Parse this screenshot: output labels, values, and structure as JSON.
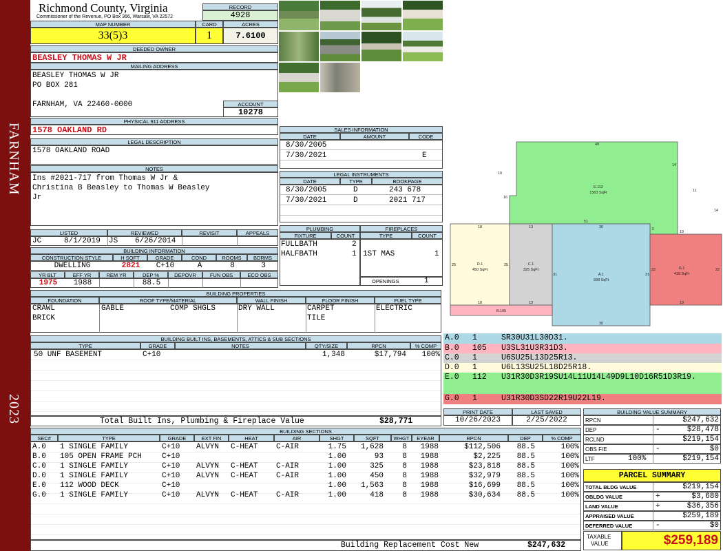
{
  "sidebar": {
    "city": "FARNHAM",
    "year": "2023"
  },
  "header": {
    "county": "Richmond County, Virginia",
    "office": "Commissioner of the Revenue, PO Box 366, Warsaw, VA 22572",
    "record_label": "RECORD",
    "record": "4928",
    "map_label": "MAP NUMBER",
    "map": "33(5)3",
    "card_label": "CARD",
    "card": "1",
    "acres_label": "ACRES",
    "acres": "7.6100"
  },
  "owner": {
    "deeded_label": "DEEDED OWNER",
    "deeded": "BEASLEY THOMAS W JR",
    "mailing_label": "MAILING ADDRESS",
    "mailing": [
      "BEASLEY THOMAS W JR",
      "PO BOX 281",
      "",
      "FARNHAM, VA 22460-0000"
    ],
    "account_label": "ACCOUNT",
    "account": "10278",
    "address_label": "PHYSICAL 911 ADDRESS",
    "address": "1578 OAKLAND RD",
    "legal_label": "LEGAL DESCRIPTION",
    "legal": "1578 OAKLAND ROAD",
    "notes_label": "NOTES",
    "notes": [
      "Ins #2021-717 from Thomas W Jr &",
      "Christina B Beasley to Thomas W Beasley",
      "Jr"
    ]
  },
  "listing": {
    "headers": [
      "LISTED",
      "REVIEWED",
      "REVISIT",
      "APPEALS"
    ],
    "listed_by": "JC",
    "listed": "8/1/2019",
    "reviewed_by": "JS",
    "reviewed": "6/26/2014"
  },
  "building_info": {
    "title": "BUILDING INFORMATION",
    "headers": [
      "CONSTRUCTION STYLE",
      "H SQFT",
      "GRADE",
      "COND",
      "ROOMS",
      "BDRMS"
    ],
    "values": [
      "DWELLING",
      "2821",
      "C+10",
      "A",
      "8",
      "3"
    ],
    "headers2": [
      "YR BLT",
      "EFF YR",
      "REM YR",
      "DEP %",
      "DEPOVR",
      "FUN OBS",
      "ECO OBS"
    ],
    "values2": [
      "1975",
      "1988",
      "",
      "88.5",
      "",
      "",
      ""
    ]
  },
  "properties": {
    "title": "BUILDING PROPERTIES",
    "headers": [
      "FOUNDATION",
      "ROOF TYPE/MATERIAL",
      "WALL FINISH",
      "FLOOR FINISH",
      "FUEL TYPE"
    ],
    "foundation": [
      "CRAWL",
      "BRICK"
    ],
    "roof_type": "GABLE",
    "roof_material": "COMP SHGLS",
    "wall": "DRY WALL",
    "floor": [
      "CARPET",
      "TILE"
    ],
    "fuel": "ELECTRIC"
  },
  "builtins": {
    "title": "BUILDING BUILT INS, BASEMENTS, ATTICS & SUB SECTIONS",
    "headers": [
      "TYPE",
      "GRADE",
      "NOTES",
      "QTY/SIZE",
      "RPCN",
      "% COMP"
    ],
    "rows": [
      {
        "type": "50 UNF BASEMENT",
        "grade": "C+10",
        "notes": "",
        "qty": "1,348",
        "rpcn": "$17,794",
        "comp": "100%"
      }
    ],
    "total_label": "Total Built Ins, Plumbing & Fireplace Value",
    "total": "$28,771"
  },
  "sales": {
    "title": "SALES INFORMATION",
    "headers": [
      "DATE",
      "AMOUNT",
      "CODE"
    ],
    "rows": [
      {
        "date": "8/30/2005",
        "amount": "",
        "code": ""
      },
      {
        "date": "7/30/2021",
        "amount": "",
        "code": "E"
      }
    ]
  },
  "legal_instruments": {
    "title": "LEGAL INSTRUMENTS",
    "headers": [
      "DATE",
      "TYPE",
      "BOOKPAGE"
    ],
    "rows": [
      {
        "date": "8/30/2005",
        "type": "D",
        "book": "243 678"
      },
      {
        "date": "7/30/2021",
        "type": "D",
        "book": "2021 717"
      }
    ]
  },
  "plumbing": {
    "title": "PLUMBING",
    "headers": [
      "FIXTURE",
      "COUNT"
    ],
    "rows": [
      {
        "fixture": "FULLBATH",
        "count": "2"
      },
      {
        "fixture": "HALFBATH",
        "count": "1"
      }
    ]
  },
  "fireplaces": {
    "title": "FIREPLACES",
    "headers": [
      "TYPE",
      "COUNT"
    ],
    "rows": [
      {
        "type": "1ST MAS",
        "count": "1"
      }
    ],
    "openings_label": "OPENINGS",
    "openings": "1"
  },
  "sketch": {
    "labels": [
      {
        "id": "E.112",
        "area": "1563 SqFt",
        "color": "#90ee90"
      },
      {
        "id": "D.1",
        "area": "450 SqFt",
        "color": "#fffbdc"
      },
      {
        "id": "C.1",
        "area": "325 SqFt",
        "color": "#d3d3d3"
      },
      {
        "id": "A.1",
        "area": "938 SqFt",
        "color": "#add8e6"
      },
      {
        "id": "G.1",
        "area": "418 SqFt",
        "color": "#f08080"
      },
      {
        "id": "B.105",
        "area": "",
        "color": "#ffb6c1"
      }
    ],
    "dims": [
      "49",
      "14",
      "10",
      "11",
      "16",
      "14",
      "51",
      "18",
      "13",
      "30",
      "3",
      "19",
      "25",
      "25",
      "31",
      "31",
      "22",
      "22",
      "18",
      "13",
      "19",
      "30"
    ]
  },
  "legend": [
    {
      "code": "A.0",
      "n": "1",
      "desc": "SR30U31L30D31.",
      "color": "#add8e6"
    },
    {
      "code": "B.0",
      "n": "105",
      "desc": "U3SL31U3R31D3.",
      "color": "#ffb6c1"
    },
    {
      "code": "C.0",
      "n": "1",
      "desc": "U6SU25L13D25R13.",
      "color": "#d3d3d3"
    },
    {
      "code": "D.0",
      "n": "1",
      "desc": "U6L13SU25L18D25R18.",
      "color": "#fffbdc"
    },
    {
      "code": "E.0",
      "n": "112",
      "desc": "U31R30D3R19SU14L11U14L49D9L10D16R51D3R19.",
      "color": "#90ee90"
    },
    {
      "code": "G.0",
      "n": "1",
      "desc": "U31R30D3SD22R19U22L19.",
      "color": "#f08080"
    }
  ],
  "dates": {
    "print_label": "PRINT DATE",
    "print": "10/26/2023",
    "saved_label": "LAST SAVED",
    "saved": "2/25/2022"
  },
  "sections": {
    "title": "BUILDING SECTIONS",
    "headers": [
      "SEC#",
      "TYPE",
      "GRADE",
      "EXT FIN",
      "HEAT",
      "AIR",
      "SHGT",
      "SQFT",
      "WHGT",
      "EYEAR",
      "RPCN",
      "DEP",
      "% COMP"
    ],
    "rows": [
      [
        "A.0",
        "1 SINGLE FAMILY",
        "C+10",
        "ALVYN",
        "C-HEAT",
        "C-AIR",
        "1.75",
        "1,628",
        "8",
        "1988",
        "$112,506",
        "88.5",
        "100%"
      ],
      [
        "B.0",
        "105 OPEN FRAME PCH",
        "C+10",
        "",
        "",
        "",
        "1.00",
        "93",
        "8",
        "1988",
        "$2,225",
        "88.5",
        "100%"
      ],
      [
        "C.0",
        "1 SINGLE FAMILY",
        "C+10",
        "ALVYN",
        "C-HEAT",
        "C-AIR",
        "1.00",
        "325",
        "8",
        "1988",
        "$23,818",
        "88.5",
        "100%"
      ],
      [
        "D.0",
        "1 SINGLE FAMILY",
        "C+10",
        "ALVYN",
        "C-HEAT",
        "C-AIR",
        "1.00",
        "450",
        "8",
        "1988",
        "$32,979",
        "88.5",
        "100%"
      ],
      [
        "E.0",
        "112 WOOD DECK",
        "C+10",
        "",
        "",
        "",
        "1.00",
        "1,563",
        "8",
        "1988",
        "$16,699",
        "88.5",
        "100%"
      ],
      [
        "G.0",
        "1 SINGLE FAMILY",
        "C+10",
        "ALVYN",
        "C-HEAT",
        "C-AIR",
        "1.00",
        "418",
        "8",
        "1988",
        "$30,634",
        "88.5",
        "100%"
      ]
    ],
    "total_label": "Building Replacement Cost New",
    "total": "$247,632"
  },
  "value_summary": {
    "title": "BUILDING VALUE SUMMARY",
    "rows": [
      {
        "label": "RPCN",
        "sign": "",
        "value": "$247,632"
      },
      {
        "label": "DEP",
        "sign": "-",
        "value": "$28,478"
      },
      {
        "label": "RCLND",
        "sign": "",
        "value": "$219,154"
      },
      {
        "label": "OBS F/E",
        "sign": "-",
        "value": "$0"
      },
      {
        "label": "LTF",
        "pct": "100%",
        "sign": "",
        "value": "$219,154"
      }
    ]
  },
  "parcel": {
    "title": "PARCEL SUMMARY",
    "rows": [
      {
        "label": "TOTAL BLDG VALUE",
        "sign": "",
        "value": "$219,154"
      },
      {
        "label": "OBLDG VALUE",
        "sign": "+",
        "value": "$3,680"
      },
      {
        "label": "LAND VALUE",
        "sign": "+",
        "value": "$36,356"
      },
      {
        "label": "APPRAISED VALUE",
        "sign": "",
        "value": "$259,189"
      },
      {
        "label": "DEFERRED VALUE",
        "sign": "-",
        "value": "$0"
      }
    ],
    "taxable_label": [
      "TAXABLE",
      "VALUE"
    ],
    "taxable": "$259,189"
  },
  "colors": {
    "header_blue": "#c5dde9",
    "accent_red": "#c8101a",
    "sidebar": "#7d0f0f",
    "highlight": "#ffff33"
  },
  "photos": [
    "house-photo-1",
    "house-photo-2",
    "house-photo-3",
    "house-photo-4",
    "house-photo-5",
    "house-photo-6",
    "house-photo-7",
    "house-photo-8",
    "house-photo-9",
    "house-photo-10",
    "house-photo-11"
  ]
}
